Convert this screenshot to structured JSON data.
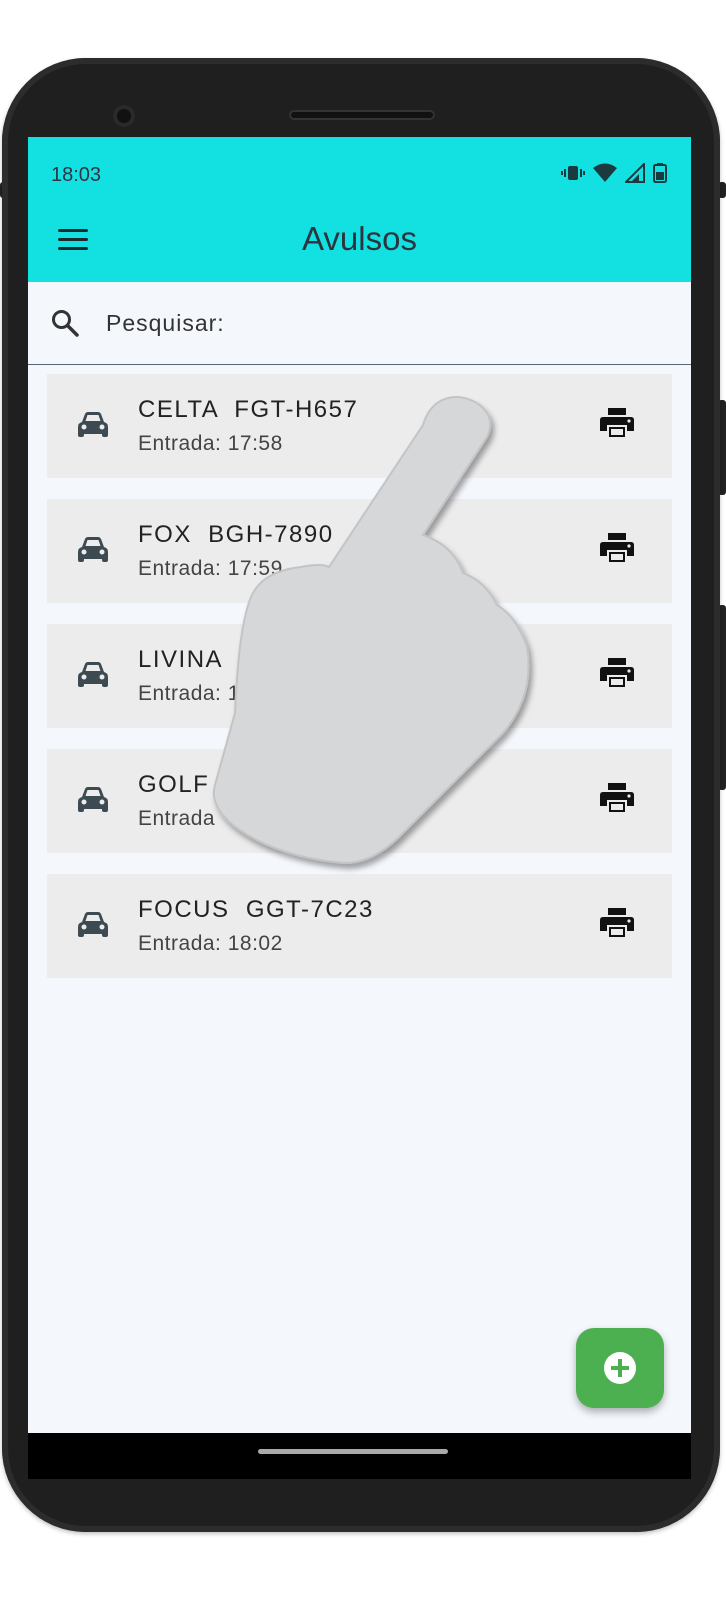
{
  "status_bar": {
    "time": "18:03",
    "icons": [
      "vibrate-icon",
      "wifi-icon",
      "signal-icon",
      "battery-icon"
    ]
  },
  "app_bar": {
    "menu_icon": "menu-icon",
    "title": "Avulsos",
    "background_color": "#13e0e0"
  },
  "search": {
    "icon": "search-icon",
    "placeholder": "Pesquisar:",
    "value": ""
  },
  "list": {
    "items": [
      {
        "title": "CELTA  FGT-H657",
        "subtitle": "Entrada: 17:58"
      },
      {
        "title": "FOX  BGH-7890",
        "subtitle": "Entrada: 17:59"
      },
      {
        "title": "LIVINA",
        "subtitle": "Entrada: 1"
      },
      {
        "title": "GOLF  C",
        "subtitle": "Entrada"
      },
      {
        "title": "FOCUS  GGT-7C23",
        "subtitle": "Entrada: 18:02"
      }
    ],
    "item_icon": "car-icon",
    "action_icon": "print-icon"
  },
  "fab": {
    "icon": "add-circle-icon",
    "color": "#4caf50"
  },
  "overlay": {
    "icon": "pointing-hand-icon"
  }
}
